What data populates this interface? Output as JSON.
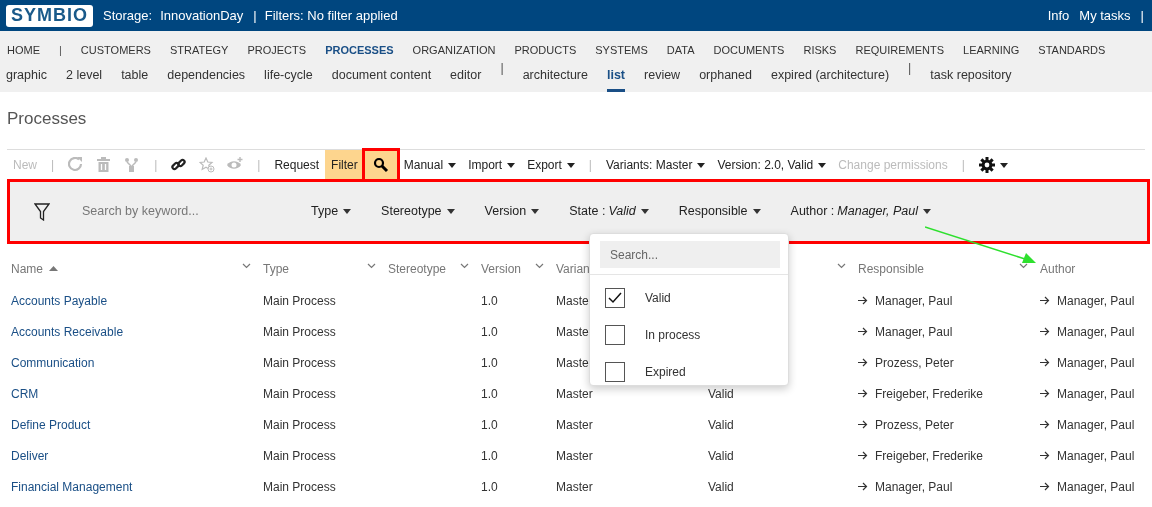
{
  "header": {
    "logo": "SYMBIO",
    "storage_label": "Storage:",
    "storage": "InnovationDay",
    "separator": "|",
    "filters": "Filters: No filter applied",
    "links": [
      "Info",
      "My tasks"
    ],
    "end_separator": "|"
  },
  "main_menu": [
    {
      "kind": "link",
      "label": "HOME",
      "selected": false
    },
    {
      "kind": "separator",
      "label": "|"
    },
    {
      "kind": "link",
      "label": "CUSTOMERS",
      "selected": false
    },
    {
      "kind": "link",
      "label": "STRATEGY",
      "selected": false
    },
    {
      "kind": "link",
      "label": "PROJECTS",
      "selected": false
    },
    {
      "kind": "link",
      "label": "PROCESSES",
      "selected": true
    },
    {
      "kind": "link",
      "label": "ORGANIZATION",
      "selected": false
    },
    {
      "kind": "link",
      "label": "PRODUCTS",
      "selected": false
    },
    {
      "kind": "link",
      "label": "SYSTEMS",
      "selected": false
    },
    {
      "kind": "link",
      "label": "DATA",
      "selected": false
    },
    {
      "kind": "link",
      "label": "DOCUMENTS",
      "selected": false
    },
    {
      "kind": "link",
      "label": "RISKS",
      "selected": false
    },
    {
      "kind": "link",
      "label": "REQUIREMENTS",
      "selected": false
    },
    {
      "kind": "link",
      "label": "LEARNING",
      "selected": false
    },
    {
      "kind": "link",
      "label": "STANDARDS",
      "selected": false
    }
  ],
  "sub_menu": [
    {
      "kind": "link",
      "label": "graphic",
      "selected": false
    },
    {
      "kind": "link",
      "label": "2 level",
      "selected": false
    },
    {
      "kind": "link",
      "label": "table",
      "selected": false
    },
    {
      "kind": "link",
      "label": "dependencies",
      "selected": false
    },
    {
      "kind": "link",
      "label": "life-cycle",
      "selected": false
    },
    {
      "kind": "link",
      "label": "document content",
      "selected": false
    },
    {
      "kind": "link",
      "label": "editor",
      "selected": false
    },
    {
      "kind": "separator",
      "label": "|"
    },
    {
      "kind": "link",
      "label": "architecture",
      "selected": false
    },
    {
      "kind": "link",
      "label": "list",
      "selected": true
    },
    {
      "kind": "link",
      "label": "review",
      "selected": false
    },
    {
      "kind": "link",
      "label": "orphaned",
      "selected": false
    },
    {
      "kind": "link",
      "label": "expired (architecture)",
      "selected": false
    },
    {
      "kind": "separator",
      "label": "|"
    },
    {
      "kind": "link",
      "label": "task repository",
      "selected": false
    }
  ],
  "page_title": "Processes",
  "toolbar": [
    {
      "kind": "button",
      "label": "New",
      "disabled": true
    },
    {
      "kind": "separator",
      "label": "|"
    },
    {
      "kind": "refresh",
      "disabled": true
    },
    {
      "kind": "trash",
      "disabled": true
    },
    {
      "kind": "hierarchy",
      "disabled": true
    },
    {
      "kind": "separator",
      "label": "|"
    },
    {
      "kind": "link",
      "disabled": false
    },
    {
      "kind": "star",
      "disabled": true
    },
    {
      "kind": "eye",
      "disabled": true
    },
    {
      "kind": "separator",
      "label": "|"
    },
    {
      "kind": "button",
      "label": "Request",
      "disabled": false
    },
    {
      "kind": "button",
      "label": "Filter",
      "disabled": false,
      "selected": true
    },
    {
      "kind": "search",
      "disabled": false,
      "selected": true,
      "highlighted": true
    },
    {
      "kind": "dropdown",
      "label": "Manual",
      "disabled": false
    },
    {
      "kind": "dropdown",
      "label": "Import",
      "disabled": false
    },
    {
      "kind": "dropdown",
      "label": "Export",
      "disabled": false
    },
    {
      "kind": "separator",
      "label": "|"
    },
    {
      "kind": "dropdown",
      "label": "Variants: Master",
      "disabled": false
    },
    {
      "kind": "dropdown",
      "label": "Version: 2.0, Valid",
      "disabled": false
    },
    {
      "kind": "button",
      "label": "Change permissions",
      "disabled": true
    },
    {
      "kind": "separator",
      "label": "|"
    },
    {
      "kind": "settings",
      "disabled": false,
      "caret": true
    }
  ],
  "filter_bar": {
    "highlighted": true,
    "placeholder": "Search by keyword...",
    "filters": [
      {
        "label": "Type"
      },
      {
        "label": "Stereotype"
      },
      {
        "label": "Version"
      },
      {
        "label": "State :",
        "value": "Valid"
      },
      {
        "label": "Responsible"
      },
      {
        "label": "Author :",
        "value": "Manager, Paul"
      }
    ]
  },
  "annotation": {
    "kind": "arrow"
  },
  "state_dropdown": {
    "placeholder": "Search...",
    "options": [
      {
        "label": "Valid",
        "checked": true
      },
      {
        "label": "In process",
        "checked": false
      },
      {
        "label": "Expired",
        "checked": false
      }
    ]
  },
  "table": {
    "columns": [
      {
        "label": "Name",
        "sorted": true,
        "menu": true
      },
      {
        "label": "Type",
        "menu": true
      },
      {
        "label": "Stereotype",
        "menu": true
      },
      {
        "label": "Version",
        "menu": true
      },
      {
        "label": "Varian",
        "menu": false
      },
      {
        "menu": true
      },
      {
        "label": "Responsible",
        "menu": true
      },
      {
        "label": "Author",
        "menu": false
      }
    ],
    "rows": [
      {
        "name": "Accounts Payable",
        "type": "Main Process",
        "version": "1.0",
        "variant": "Maste",
        "responsible": "Manager, Paul",
        "author": "Manager, Paul"
      },
      {
        "name": "Accounts Receivable",
        "type": "Main Process",
        "version": "1.0",
        "variant": "Maste",
        "responsible": "Manager, Paul",
        "author": "Manager, Paul"
      },
      {
        "name": "Communication",
        "type": "Main Process",
        "version": "1.0",
        "variant": "Maste",
        "responsible": "Prozess, Peter",
        "author": "Manager, Paul"
      },
      {
        "name": "CRM",
        "type": "Main Process",
        "version": "1.0",
        "variant": "Master",
        "state": "Valid",
        "responsible": "Freigeber, Frederike",
        "author": "Manager, Paul"
      },
      {
        "name": "Define Product",
        "type": "Main Process",
        "version": "1.0",
        "variant": "Master",
        "state": "Valid",
        "responsible": "Prozess, Peter",
        "author": "Manager, Paul"
      },
      {
        "name": "Deliver",
        "type": "Main Process",
        "version": "1.0",
        "variant": "Master",
        "state": "Valid",
        "responsible": "Freigeber, Frederike",
        "author": "Manager, Paul"
      },
      {
        "name": "Financial Management",
        "type": "Main Process",
        "version": "1.0",
        "variant": "Master",
        "state": "Valid",
        "responsible": "Manager, Paul",
        "author": "Manager, Paul"
      }
    ]
  }
}
